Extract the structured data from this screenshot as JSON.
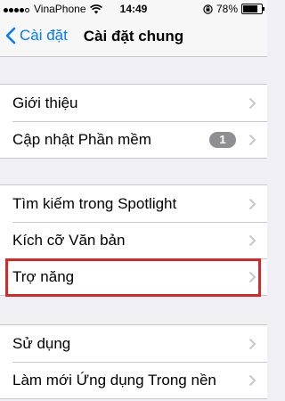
{
  "status_bar": {
    "carrier": "VinaPhone",
    "time": "14:49",
    "battery_percent": "78%",
    "battery_level": 0.78,
    "signal_bars": 4,
    "signal_icon": "signal-dots-icon",
    "wifi_icon": "wifi-icon",
    "lock_icon": "orientation-lock-icon"
  },
  "nav": {
    "back_label": "Cài đặt",
    "title": "Cài đặt chung",
    "accent_color": "#007aff"
  },
  "groups": [
    {
      "items": [
        {
          "label": "Giới thiệu"
        },
        {
          "label": "Cập nhật Phần mềm",
          "badge": "1"
        }
      ]
    },
    {
      "items": [
        {
          "label": "Tìm kiếm trong Spotlight"
        },
        {
          "label": "Kích cỡ Văn bản"
        },
        {
          "label": "Trợ năng",
          "highlighted": true
        }
      ]
    },
    {
      "items": [
        {
          "label": "Sử dụng"
        },
        {
          "label": "Làm mới Ứng dụng Trong nền"
        }
      ]
    }
  ],
  "highlight_color": "#d22a2a"
}
